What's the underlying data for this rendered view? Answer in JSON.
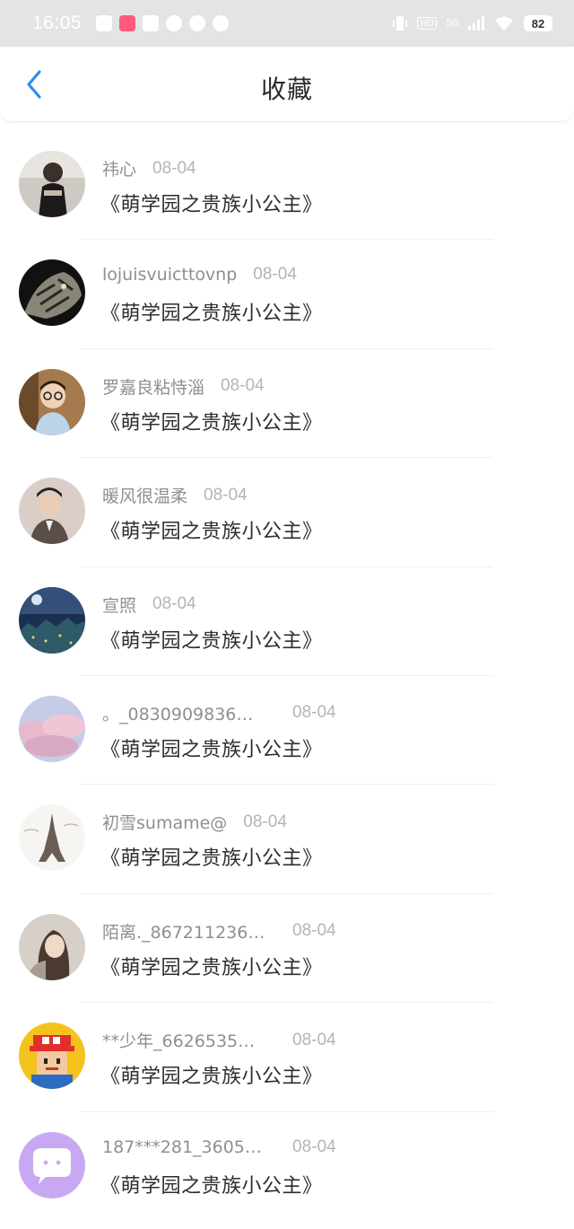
{
  "status_bar": {
    "time": "16:05",
    "network": "5G",
    "hd": "HD",
    "battery": "82"
  },
  "header": {
    "title": "收藏",
    "back_icon": "chevron-left-icon",
    "accent_color": "#2b8ef0"
  },
  "items": [
    {
      "name": "祎心",
      "date": "08-04",
      "title": "《萌学园之贵族小公主》",
      "avatar": "photo-girl-dark"
    },
    {
      "name": "lojuisvuicttovnp",
      "date": "08-04",
      "title": "《萌学园之贵族小公主》",
      "avatar": "tiger"
    },
    {
      "name": "罗嘉良粘恃淄",
      "date": "08-04",
      "title": "《萌学园之贵族小公主》",
      "avatar": "photo-kid-glasses"
    },
    {
      "name": "暖风很温柔",
      "date": "08-04",
      "title": "《萌学园之贵族小公主》",
      "avatar": "photo-man"
    },
    {
      "name": "宣照",
      "date": "08-04",
      "title": "《萌学园之贵族小公主》",
      "avatar": "night-city"
    },
    {
      "name": "。_0830909836…",
      "date": "08-04",
      "title": "《萌学园之贵族小公主》",
      "avatar": "pink-clouds"
    },
    {
      "name": "初雪sumame@",
      "date": "08-04",
      "title": "《萌学园之贵族小公主》",
      "avatar": "eiffel-tower"
    },
    {
      "name": "陌离._867211236…",
      "date": "08-04",
      "title": "《萌学园之贵族小公主》",
      "avatar": "photo-girl-light"
    },
    {
      "name": "**少年_6626535…",
      "date": "08-04",
      "title": "《萌学园之贵族小公主》",
      "avatar": "pixel-boy"
    },
    {
      "name": "187***281_3605…",
      "date": "08-04",
      "title": "《萌学园之贵族小公主》",
      "avatar": "default-chat"
    }
  ]
}
